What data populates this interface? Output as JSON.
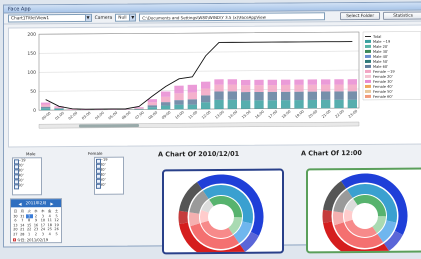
{
  "window": {
    "title": "Face App"
  },
  "toolbar": {
    "chart_select": "Chart1Title\\View1",
    "camera_label": "Camera",
    "camera_select": "Null",
    "path": "C:\\Documents and Settings\\W80\\WIND\\Y 3.5 (x)\\FaceAppView",
    "select_folder_button": "Select Folder",
    "statistics_button": "Statistics"
  },
  "legend": {
    "items": [
      {
        "label": "Total",
        "color": "#111111",
        "type": "line"
      },
      {
        "label": "Male ~19",
        "color": "#3aa0a0"
      },
      {
        "label": "Male 20'",
        "color": "#56b3a6"
      },
      {
        "label": "Male 30'",
        "color": "#3d8a5a"
      },
      {
        "label": "Male 40'",
        "color": "#6a8fcf"
      },
      {
        "label": "Male 50'",
        "color": "#2f7a7a"
      },
      {
        "label": "Male 60'",
        "color": "#5f7d9c"
      },
      {
        "label": "Female ~19",
        "color": "#f2a5c3"
      },
      {
        "label": "Female 20'",
        "color": "#f4c2d0"
      },
      {
        "label": "Female 30'",
        "color": "#e88ad1"
      },
      {
        "label": "Female 40'",
        "color": "#f0a65a"
      },
      {
        "label": "Female 50'",
        "color": "#e8c79b"
      },
      {
        "label": "Female 60'",
        "color": "#f29a7b"
      }
    ]
  },
  "chart_data": {
    "type": "bar",
    "ylim": [
      0,
      200
    ],
    "yticks": [
      0,
      50,
      100,
      150,
      200
    ],
    "categories": [
      "00:00",
      "01:00",
      "02:00",
      "03:00",
      "04:00",
      "05:00",
      "06:00",
      "07:00",
      "08:00",
      "09:00",
      "10:00",
      "11:00",
      "12:00",
      "13:00",
      "14:00",
      "15:00",
      "16:00",
      "17:00",
      "18:00",
      "19:00",
      "20:00",
      "21:00",
      "22:00",
      "23:00"
    ],
    "total": [
      28,
      10,
      3,
      2,
      2,
      2,
      2,
      8,
      35,
      60,
      80,
      85,
      140,
      175,
      175,
      175,
      175,
      175,
      175,
      175,
      175,
      175,
      175,
      175
    ],
    "series": [
      {
        "color": "#3aa0a0",
        "values": [
          5,
          3,
          0,
          0,
          0,
          0,
          0,
          1,
          6,
          10,
          12,
          12,
          18,
          24,
          24,
          22,
          22,
          22,
          22,
          22,
          22,
          22,
          22,
          22
        ]
      },
      {
        "color": "#5f7d9c",
        "values": [
          4,
          2,
          0,
          0,
          0,
          0,
          0,
          1,
          5,
          9,
          12,
          14,
          18,
          22,
          22,
          22,
          22,
          22,
          22,
          22,
          22,
          22,
          22,
          22
        ]
      },
      {
        "color": "#f2a5c3",
        "values": [
          6,
          3,
          1,
          0,
          0,
          0,
          0,
          2,
          8,
          14,
          18,
          18,
          18,
          18,
          18,
          18,
          18,
          18,
          18,
          18,
          18,
          18,
          18,
          18
        ]
      },
      {
        "color": "#e88ad1",
        "values": [
          5,
          2,
          1,
          1,
          1,
          1,
          1,
          2,
          8,
          14,
          20,
          20,
          18,
          14,
          14,
          14,
          14,
          14,
          14,
          14,
          14,
          14,
          14,
          14
        ]
      }
    ]
  },
  "filters": {
    "male_label": "Male",
    "female_label": "Female",
    "male_items": [
      "~19",
      "20'",
      "30'",
      "40'",
      "50'",
      "60'"
    ],
    "female_items": [
      "~19",
      "20'",
      "30'",
      "40'",
      "50'",
      "60'"
    ]
  },
  "calendar": {
    "header": "2011年2月",
    "days_head": [
      "日",
      "月",
      "火",
      "水",
      "木",
      "金",
      "土"
    ],
    "cells": [
      "30",
      "31",
      "1",
      "2",
      "3",
      "4",
      "5",
      "6",
      "7",
      "8",
      "9",
      "10",
      "11",
      "12",
      "13",
      "14",
      "15",
      "16",
      "17",
      "18",
      "19",
      "20",
      "21",
      "22",
      "23",
      "24",
      "25",
      "26",
      "27",
      "28",
      "1",
      "2",
      "3",
      "4",
      "5"
    ],
    "selected": "1",
    "today": "今日: 2011/02/19"
  },
  "pies": [
    {
      "title": "A Chart Of 2010/12/01",
      "border": "#29408a"
    },
    {
      "title": "A Chart Of 12:00",
      "border": "#5a9f5a"
    }
  ]
}
